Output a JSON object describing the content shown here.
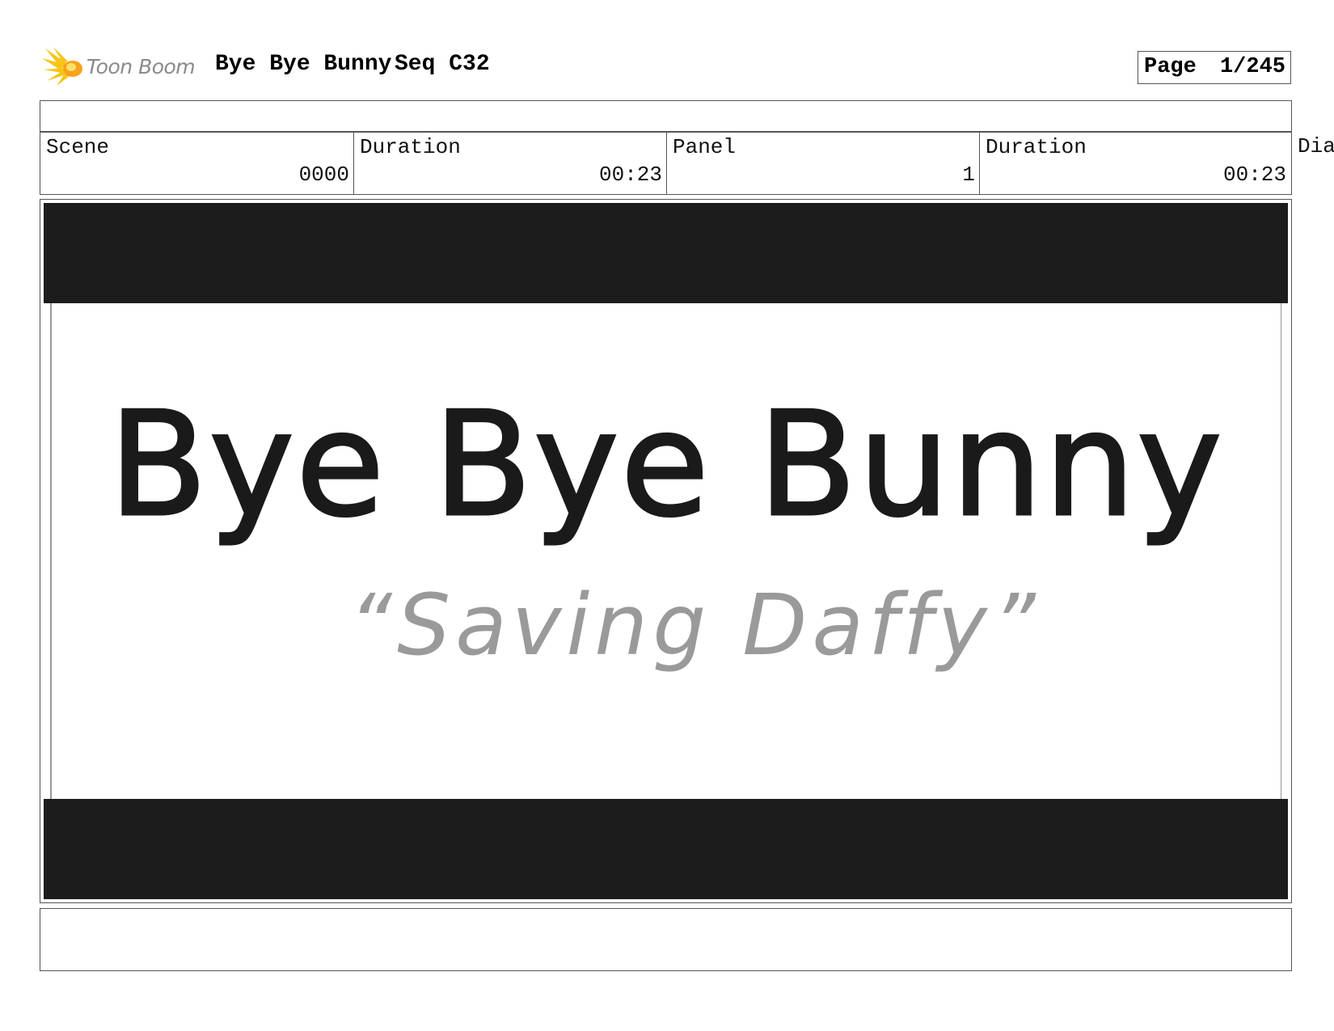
{
  "header": {
    "logo_text": "Toon Boom",
    "project_title": "Bye Bye Bunny",
    "sequence": "Seq C32",
    "page_label": "Page",
    "page_number": "1/245"
  },
  "info": {
    "scene_label": "Scene",
    "scene_value": "0000",
    "scene_duration_label": "Duration",
    "scene_duration_value": "00:23",
    "panel_label": "Panel",
    "panel_value": "1",
    "panel_duration_label": "Duration",
    "panel_duration_value": "00:23",
    "overflow_label": "Dia"
  },
  "panel": {
    "title_text": "Bye Bye Bunny",
    "subtitle_text": "“Saving Daffy”",
    "title_color": "#1a1a1a",
    "subtitle_color": "#9a9a9a",
    "letterbox_color": "#1c1c1c"
  },
  "colors": {
    "logo_burst": "#f5c518",
    "logo_text": "#8a8a8a",
    "border": "#555555"
  }
}
